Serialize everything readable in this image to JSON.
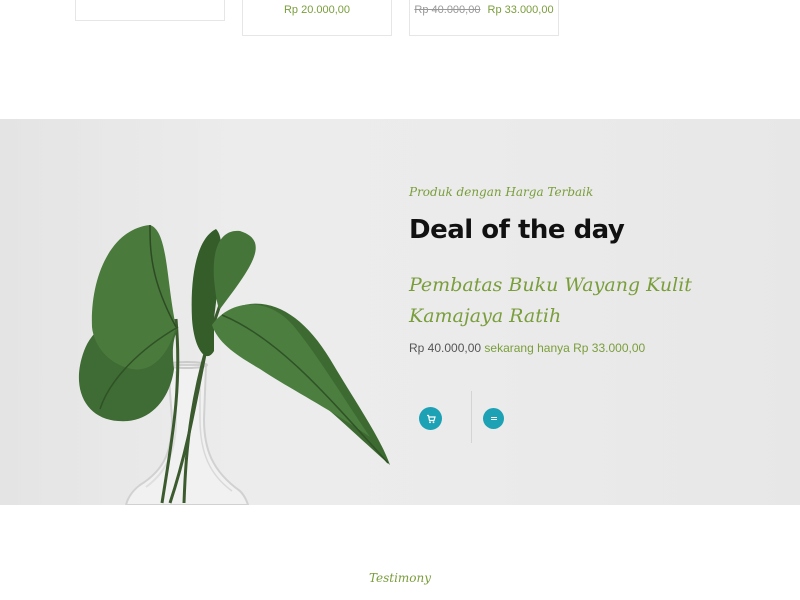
{
  "products": {
    "card2": {
      "price": "Rp 20.000,00"
    },
    "card3": {
      "old_price": "Rp 40.000,00",
      "price": "Rp 33.000,00"
    }
  },
  "deal": {
    "eyebrow": "Produk dengan Harga Terbaik",
    "title": "Deal of the day",
    "product_name": "Pembatas Buku Wayang Kulit Kamajaya Ratih",
    "price_was": "Rp 40.000,00",
    "price_now": "sekarang hanya Rp 33.000,00",
    "icons": {
      "cart": "cart-icon",
      "menu": "menu-icon"
    },
    "colors": {
      "accent": "#7a9e3c",
      "button": "#1da1b5",
      "background": "#e9e9e9"
    }
  },
  "testimony": {
    "label": "Testimony"
  }
}
